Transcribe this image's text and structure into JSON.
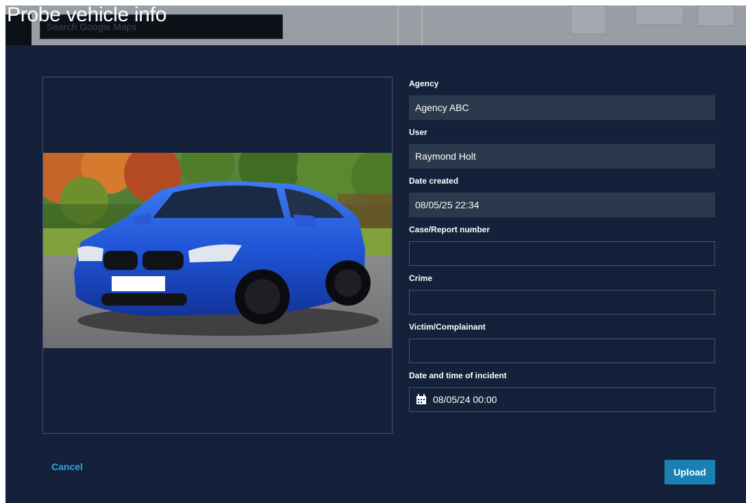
{
  "page_title": "Probe vehicle info",
  "background_map": {
    "search_placeholder": "Search Google Maps"
  },
  "image_preview": {
    "alt": "Blue BMW 3 Series Gran Turismo parked near autumn trees"
  },
  "form": {
    "agency": {
      "label": "Agency",
      "value": "Agency ABC"
    },
    "user": {
      "label": "User",
      "value": "Raymond Holt"
    },
    "date_created": {
      "label": "Date created",
      "value": "08/05/25 22:34"
    },
    "case_number": {
      "label": "Case/Report number",
      "value": ""
    },
    "crime": {
      "label": "Crime",
      "value": ""
    },
    "victim": {
      "label": "Victim/Complainant",
      "value": ""
    },
    "incident_datetime": {
      "label": "Date and time of incident",
      "value": "08/05/24 00:00",
      "icon": "calendar-icon"
    }
  },
  "actions": {
    "cancel_label": "Cancel",
    "upload_label": "Upload"
  },
  "colors": {
    "panel_background": "#15213a",
    "readonly_field": "#2a394c",
    "accent_link": "#2aa8e0",
    "primary_button": "#1a7fb3"
  }
}
